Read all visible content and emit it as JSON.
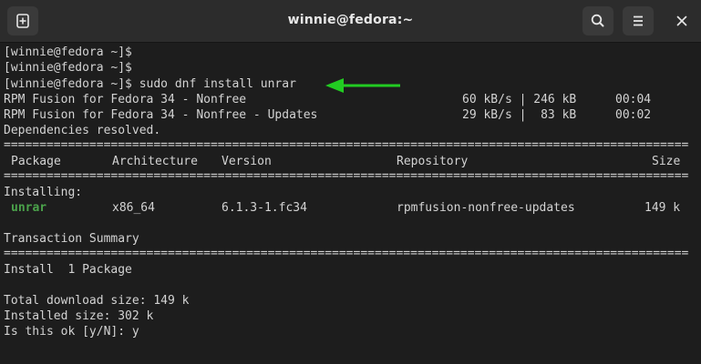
{
  "window": {
    "title": "winnie@fedora:~"
  },
  "icons": {
    "new_tab": "new-tab-icon",
    "search": "search-icon",
    "menu": "hamburger-menu-icon",
    "close": "close-icon",
    "arrow": "green-left-arrow-icon"
  },
  "colors": {
    "terminal_bg": "#1d1d1d",
    "titlebar_bg": "#2c2c2c",
    "text": "#d3d3d3",
    "package_green": "#4ba34b",
    "arrow_green": "#22cc22"
  },
  "terminal": {
    "prompt1": "[winnie@fedora ~]$",
    "prompt2": "[winnie@fedora ~]$",
    "prompt3": "[winnie@fedora ~]$ sudo dnf install unrar",
    "repo1": {
      "name": "RPM Fusion for Fedora 34 - Nonfree",
      "speed": "60 kB/s | 246 kB",
      "time": "00:04"
    },
    "repo2": {
      "name": "RPM Fusion for Fedora 34 - Nonfree - Updates",
      "speed": "29 kB/s |  83 kB",
      "time": "00:02"
    },
    "deps_resolved": "Dependencies resolved.",
    "rule_eq": "================================================================================================================================================",
    "table_headers": {
      "package": "Package",
      "architecture": "Architecture",
      "version": "Version",
      "repository": "Repository",
      "size": "Size"
    },
    "installing_label": "Installing:",
    "package_row": {
      "name": "unrar",
      "arch": "x86_64",
      "version": "6.1.3-1.fc34",
      "repo": "rpmfusion-nonfree-updates",
      "size": "149 k"
    },
    "transaction_summary": "Transaction Summary",
    "install_count": "Install  1 Package",
    "total_download": "Total download size: 149 k",
    "installed_size": "Installed size: 302 k",
    "confirm_prompt": "Is this ok [y/N]: y"
  }
}
